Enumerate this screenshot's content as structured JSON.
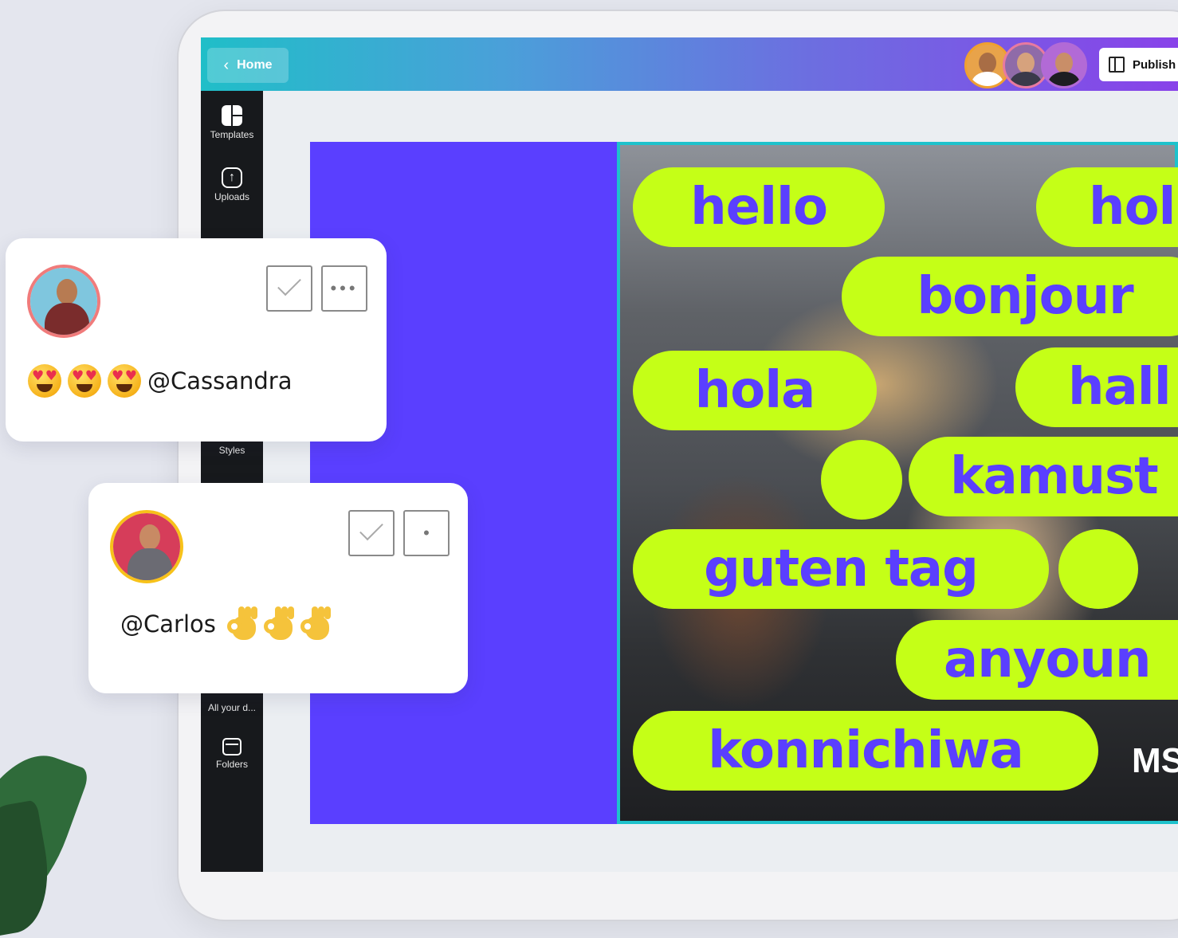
{
  "topbar": {
    "home_label": "Home",
    "publish_label": "Publish",
    "colors": {
      "gradient_start": "#20bec8",
      "gradient_end": "#8a3fea"
    }
  },
  "collaborators": [
    "avatar-1",
    "avatar-2",
    "avatar-3"
  ],
  "sidebar": {
    "items": [
      {
        "label": "Templates",
        "icon": "templates-icon"
      },
      {
        "label": "Uploads",
        "icon": "upload-icon"
      },
      {
        "label": "Styles",
        "icon": "styles-icon"
      },
      {
        "label": "All your d...",
        "icon": "designs-icon"
      },
      {
        "label": "Folders",
        "icon": "folder-icon"
      }
    ]
  },
  "design": {
    "background_color": "#5a3fff",
    "pill_color": "#c5ff17",
    "text_color": "#5a3fff",
    "words": [
      "hello",
      "hol",
      "bonjour",
      "hola",
      "hall",
      "kamust",
      "guten tag",
      "anyoun",
      "konnichiwa"
    ],
    "brand_mark": "MS"
  },
  "comments": [
    {
      "author_avatar": "user-avatar-man",
      "emojis": [
        "heart-eyes",
        "heart-eyes",
        "heart-eyes"
      ],
      "mention": "@Cassandra"
    },
    {
      "author_avatar": "user-avatar-woman",
      "mention": "@Carlos",
      "emojis": [
        "ok-hand",
        "ok-hand",
        "ok-hand"
      ]
    }
  ]
}
